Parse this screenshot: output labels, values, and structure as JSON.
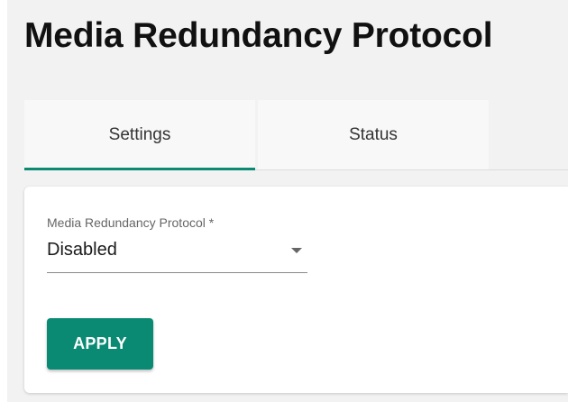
{
  "page": {
    "title": "Media Redundancy Protocol"
  },
  "tabs": [
    {
      "label": "Settings",
      "active": true
    },
    {
      "label": "Status",
      "active": false
    }
  ],
  "form": {
    "field_label": "Media Redundancy Protocol *",
    "selected_value": "Disabled",
    "dropdown_icon": "chevron-down-icon"
  },
  "actions": {
    "apply_label": "APPLY"
  },
  "colors": {
    "accent": "#0a8a73",
    "background": "#f2f2f2",
    "card": "#ffffff"
  }
}
